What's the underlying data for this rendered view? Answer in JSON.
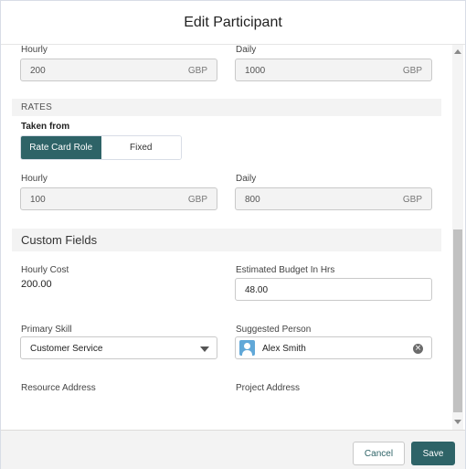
{
  "modal": {
    "title": "Edit Participant"
  },
  "top_rates": {
    "hourly_label": "Hourly",
    "hourly_value": "200",
    "hourly_unit": "GBP",
    "daily_label": "Daily",
    "daily_value": "1000",
    "daily_unit": "GBP"
  },
  "rates": {
    "section_title": "RATES",
    "taken_from_label": "Taken from",
    "options": [
      "Rate Card Role",
      "Fixed"
    ],
    "selected": "Rate Card Role",
    "hourly_label": "Hourly",
    "hourly_value": "100",
    "hourly_unit": "GBP",
    "daily_label": "Daily",
    "daily_value": "800",
    "daily_unit": "GBP"
  },
  "custom_fields": {
    "section_title": "Custom Fields",
    "hourly_cost_label": "Hourly Cost",
    "hourly_cost_value": "200.00",
    "budget_label": "Estimated Budget In Hrs",
    "budget_value": "48.00",
    "primary_skill_label": "Primary Skill",
    "primary_skill_value": "Customer Service",
    "suggested_person_label": "Suggested Person",
    "suggested_person_value": "Alex Smith",
    "resource_address_label": "Resource Address",
    "project_address_label": "Project Address"
  },
  "footer": {
    "cancel_label": "Cancel",
    "save_label": "Save"
  },
  "colors": {
    "accent": "#2e6367",
    "section_bg": "#f3f3f3",
    "avatar": "#61a8d8"
  }
}
